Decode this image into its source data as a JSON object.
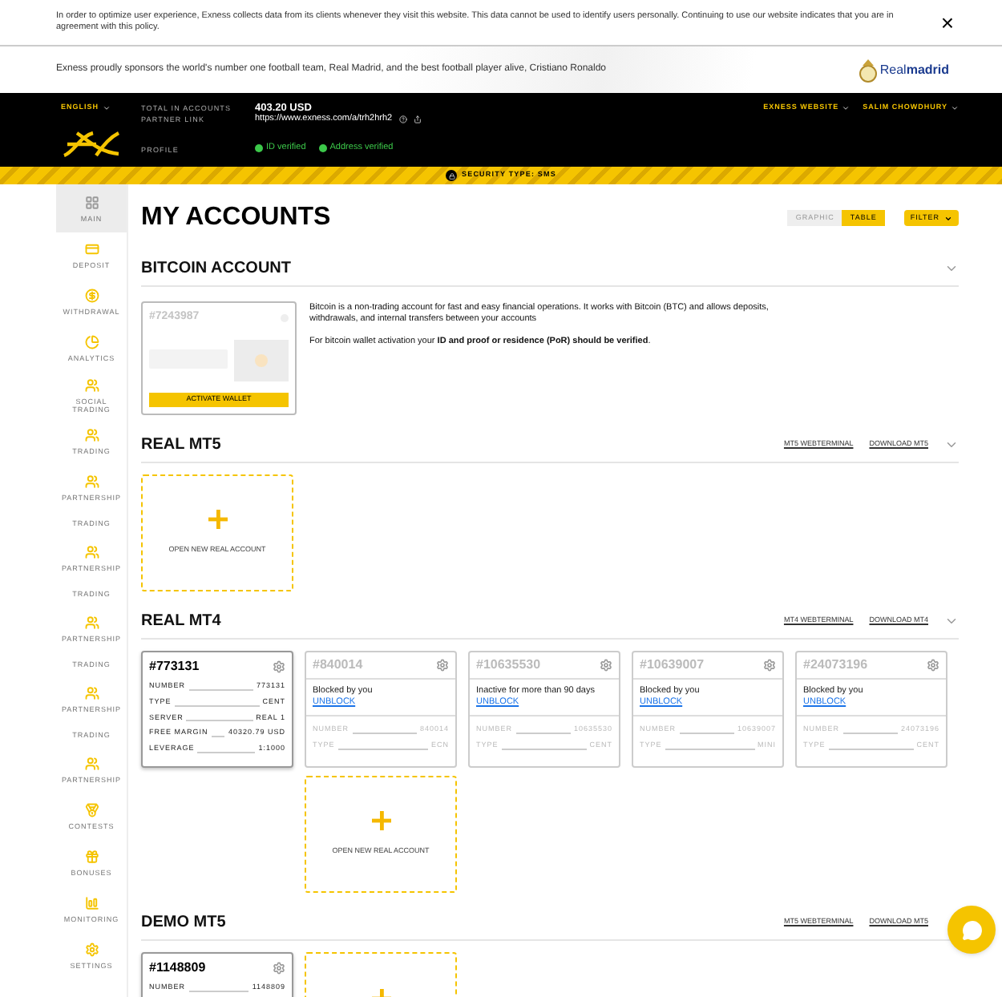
{
  "cookie_notice": {
    "text": "In order to optimize user experience, Exness collects data from its clients whenever they visit this website. This data cannot be used to identify users personally. Continuing to use our website indicates that you are in agreement with this policy.",
    "close": "×"
  },
  "sponsor_bar": {
    "text": "Exness proudly sponsors the world's number one football team, Real Madrid, and the best football player alive, Cristiano Ronaldo",
    "logo_text": "Real**madrid**"
  },
  "header": {
    "language": "ENGLISH",
    "total_label": "TOTAL IN ACCOUNTS",
    "total_value": "403.20 USD",
    "partner_label": "PARTNER LINK",
    "partner_link": "https://www.exness.com/a/trh2hrh2",
    "profile_label": "PROFILE",
    "verifications": [
      {
        "label": "ID verified",
        "verified": true
      },
      {
        "label": "Address verified",
        "verified": true
      }
    ],
    "menus": [
      "EXNESS WEBSITE",
      "SALIM CHOWDHURY"
    ]
  },
  "security_bar": {
    "text": "SECURITY TYPE: SMS"
  },
  "sidebar": {
    "items": [
      {
        "label": "MAIN",
        "kind": "grid",
        "selected": true
      },
      {
        "label": "DEPOSIT",
        "kind": "card",
        "selected": false
      },
      {
        "label": "WITHDRAWAL",
        "kind": "coin",
        "selected": false
      },
      {
        "label": "ANALYTICS",
        "kind": "pie",
        "selected": false
      },
      {
        "label": "SOCIAL TRADING",
        "kind": "people",
        "selected": false
      },
      {
        "label": "TRADING",
        "kind": "people",
        "selected": false
      },
      {
        "label": "PARTNERSHIP",
        "kind": "people",
        "selected": false
      },
      {
        "label": "TRADING",
        "kind": "text",
        "selected": false
      },
      {
        "label": "PARTNERSHIP",
        "kind": "people",
        "selected": false
      },
      {
        "label": "TRADING",
        "kind": "text",
        "selected": false
      },
      {
        "label": "PARTNERSHIP",
        "kind": "people",
        "selected": false
      },
      {
        "label": "TRADING",
        "kind": "text",
        "selected": false
      },
      {
        "label": "PARTNERSHIP",
        "kind": "people",
        "selected": false
      },
      {
        "label": "TRADING",
        "kind": "text",
        "selected": false
      },
      {
        "label": "PARTNERSHIP",
        "kind": "people",
        "selected": false
      },
      {
        "label": "CONTESTS",
        "kind": "medal",
        "selected": false
      },
      {
        "label": "BONUSES",
        "kind": "gift",
        "selected": false
      },
      {
        "label": "MONITORING",
        "kind": "bars",
        "selected": false
      },
      {
        "label": "SETTINGS",
        "kind": "gear",
        "selected": false
      }
    ]
  },
  "page": {
    "title": "MY ACCOUNTS",
    "view_toggle": [
      {
        "label": "GRAPHIC",
        "selected": false
      },
      {
        "label": "TABLE",
        "selected": true
      }
    ],
    "filter": "FILTER"
  },
  "sections": [
    {
      "kind": "bitcoin",
      "title": "BITCOIN ACCOUNT",
      "expanded": true,
      "wallet_number": "#7243987",
      "activate_button": "ACTIVATE WALLET",
      "description": [
        "Bitcoin is a non-trading account for fast and easy financial operations. It works with Bitcoin (BTC) and allows deposits, withdrawals, and internal transfers between your accounts",
        "For bitcoin wallet activation your **ID and proof or residence (PoR) should be verified**."
      ]
    },
    {
      "kind": "accounts",
      "title": "REAL MT5",
      "expanded": true,
      "links": [
        "MT5 WEBTERMINAL",
        "DOWNLOAD MT5"
      ],
      "add_card": true,
      "add_card_label": "OPEN NEW REAL ACCOUNT"
    },
    {
      "kind": "accounts",
      "title": "REAL MT4",
      "expanded": true,
      "links": [
        "MT4 WEBTERMINAL",
        "DOWNLOAD MT4"
      ],
      "accounts": [
        {
          "kind": "active",
          "number": "#773131",
          "fields": [
            {
              "label": "NUMBER",
              "value": "773131"
            },
            {
              "label": "TYPE",
              "value": "CENT"
            },
            {
              "label": "SERVER",
              "value": "REAL 1"
            },
            {
              "label": "FREE MARGIN",
              "value": "40320.79 USD"
            },
            {
              "label": "LEVERAGE",
              "value": "1:1000"
            }
          ]
        },
        {
          "kind": "blocked",
          "number": "#840014",
          "status": "Blocked by you",
          "action": "UNBLOCK",
          "fields": [
            {
              "label": "NUMBER",
              "value": "840014"
            },
            {
              "label": "TYPE",
              "value": "ECN"
            }
          ]
        },
        {
          "kind": "blocked",
          "number": "#10635530",
          "status": "Inactive for more than 90 days",
          "action": "UNBLOCK",
          "fields": [
            {
              "label": "NUMBER",
              "value": "10635530"
            },
            {
              "label": "TYPE",
              "value": "CENT"
            }
          ]
        },
        {
          "kind": "blocked",
          "number": "#10639007",
          "status": "Blocked by you",
          "action": "UNBLOCK",
          "fields": [
            {
              "label": "NUMBER",
              "value": "10639007"
            },
            {
              "label": "TYPE",
              "value": "MINI"
            }
          ]
        },
        {
          "kind": "blocked",
          "number": "#24073196",
          "status": "Blocked by you",
          "action": "UNBLOCK",
          "fields": [
            {
              "label": "NUMBER",
              "value": "24073196"
            },
            {
              "label": "TYPE",
              "value": "CENT"
            }
          ]
        }
      ],
      "add_card": true,
      "add_card_label": "OPEN NEW REAL ACCOUNT"
    },
    {
      "kind": "accounts",
      "title": "DEMO MT5",
      "links": [
        "MT5 WEBTERMINAL",
        "DOWNLOAD MT5"
      ],
      "accounts": [
        {
          "kind": "active",
          "number": "#1148809",
          "fields": [
            {
              "label": "NUMBER",
              "value": "1148809"
            }
          ]
        }
      ],
      "add_card": true
    }
  ]
}
